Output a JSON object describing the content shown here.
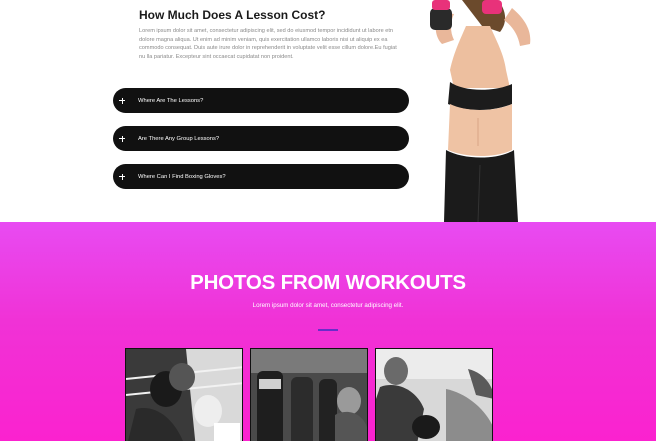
{
  "faq": {
    "title": "How Much Does A Lesson Cost?",
    "body": "Lorem ipsum dolor sit amet, consectetur adipiscing elit, sed do eiusmod tempor incididunt ut labore etn dolore magna aliqua. Ut enim ad minim veniam, quis exercitation ullamco laboris nisi ut aliquip ex ea commodo consequat. Duis aute irure dolor in reprehenderit in voluptate velit esse cillum dolore.Eu fugiat nu lla pariatur. Excepteur sint occaecat cupidatat non proident.",
    "items": [
      {
        "label": "Where Are The Lessons?",
        "icon": "plus-icon"
      },
      {
        "label": "Are There Any Group Lessons?",
        "icon": "plus-icon"
      },
      {
        "label": "Where Can I Find Boxing Gloves?",
        "icon": "plus-icon"
      }
    ]
  },
  "photos": {
    "title": "PHOTOS FROM WORKOUTS",
    "subtitle": "Lorem ipsum dolor sit amet, consectetur adipiscing elit."
  },
  "colors": {
    "accordion_bg": "#111111",
    "section_pink": "#f032d6",
    "divider": "#6a2cc9",
    "glove_pink": "#e8327a"
  }
}
